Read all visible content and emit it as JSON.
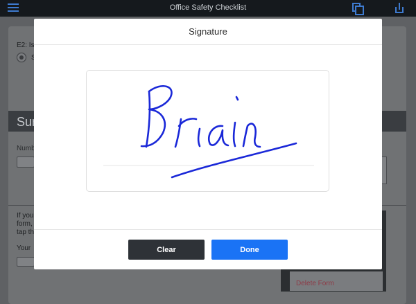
{
  "topbar": {
    "title": "Office Safety Checklist",
    "icons": [
      "menu-icon",
      "copy-icon",
      "share-icon"
    ]
  },
  "background": {
    "question_label": "E2: Is",
    "radio_label": "S",
    "section_title": "Sur",
    "field_label": "Numb",
    "instructions": [
      "If you",
      "form,",
      "tap th"
    ],
    "your_label": "Your",
    "popover_delete": "Delete Form"
  },
  "modal": {
    "title": "Signature",
    "signature_text": "Brian",
    "clear_label": "Clear",
    "done_label": "Done"
  },
  "colors": {
    "ink": "#1a28d8",
    "done_button": "#1a73f5",
    "clear_button": "#2e3237",
    "topbar_icons": "#3e7bd0",
    "delete_text": "#8e3a46"
  }
}
